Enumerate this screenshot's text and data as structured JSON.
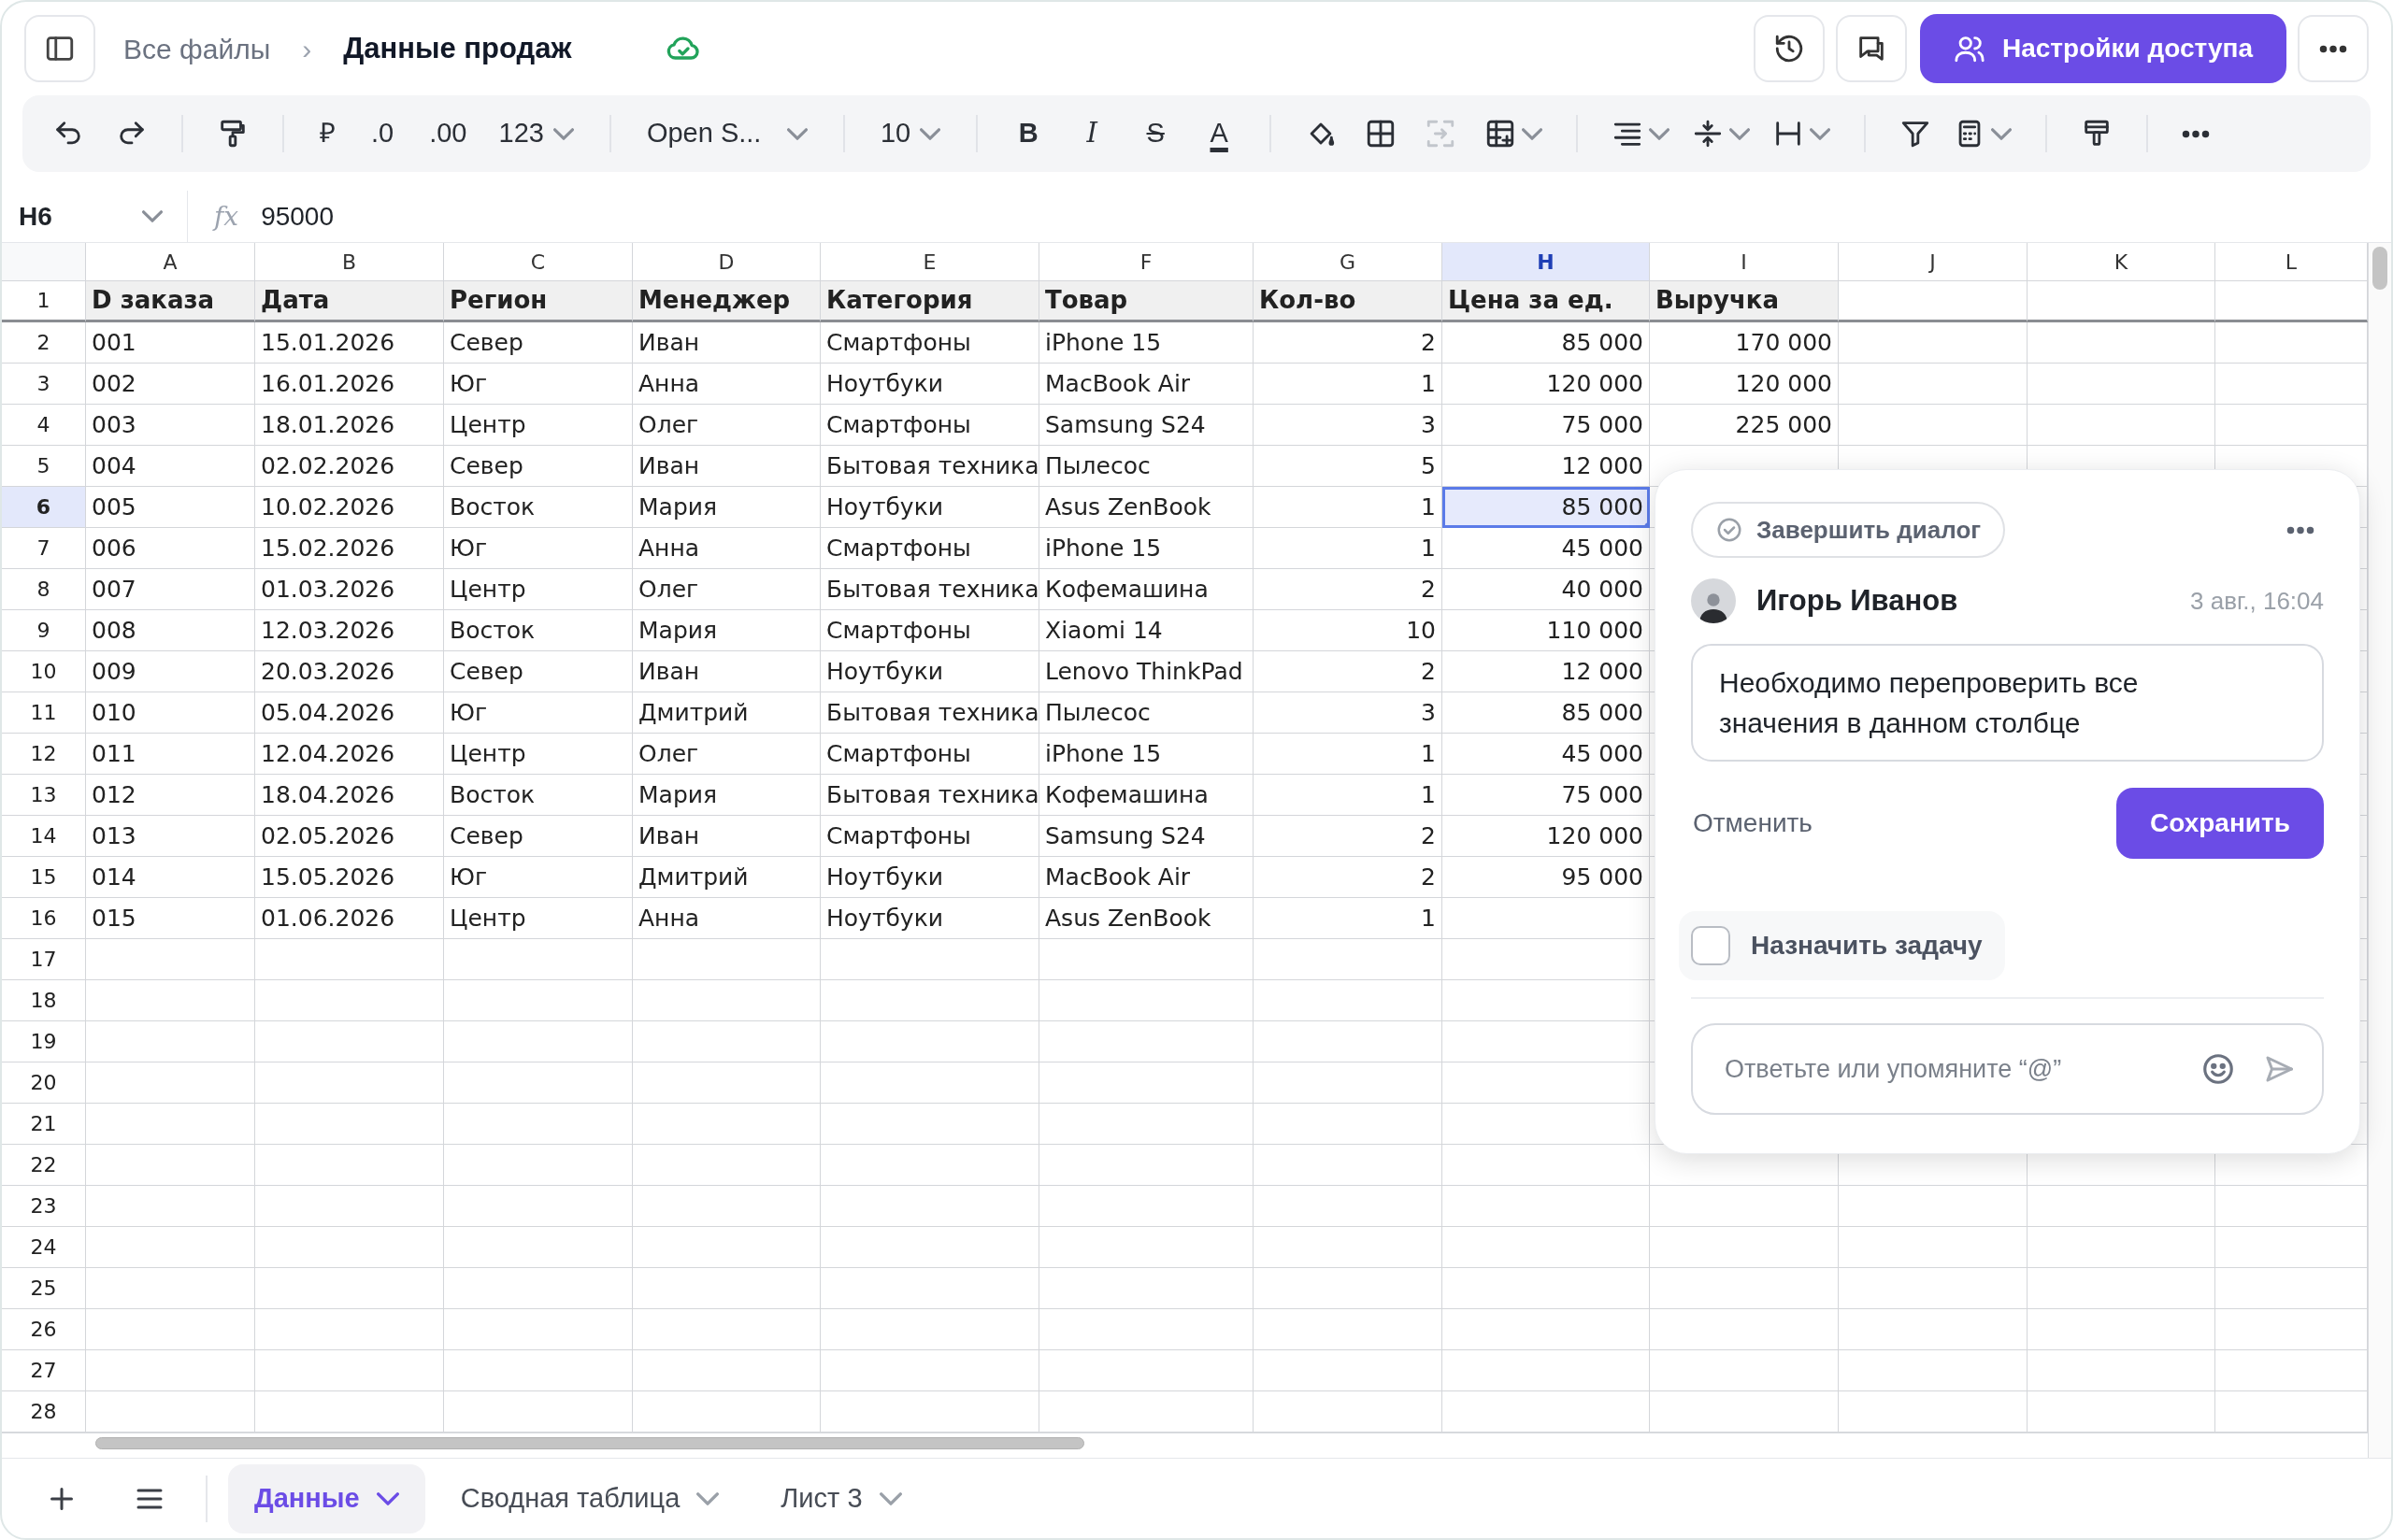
{
  "top_bar": {
    "breadcrumb_parent": "Все файлы",
    "breadcrumb_separator": "›",
    "title": "Данные продаж",
    "share_button": "Настройки доступа"
  },
  "toolbar": {
    "currency": "₽",
    "decimal_decrease": ".0",
    "decimal_increase": ".00",
    "number_format": "123",
    "font": "Open S...",
    "font_size": "10",
    "bold": "B",
    "italic": "I",
    "strikethrough": "S",
    "text_color": "A"
  },
  "formula_bar": {
    "cell_ref": "H6",
    "fx": "fx",
    "value": "95000"
  },
  "grid": {
    "columns": [
      {
        "letter": "A",
        "selected": false
      },
      {
        "letter": "B",
        "selected": false
      },
      {
        "letter": "C",
        "selected": false
      },
      {
        "letter": "D",
        "selected": false
      },
      {
        "letter": "E",
        "selected": false
      },
      {
        "letter": "F",
        "selected": false
      },
      {
        "letter": "G",
        "selected": false,
        "numeric": true
      },
      {
        "letter": "H",
        "selected": true,
        "numeric": true
      },
      {
        "letter": "I",
        "selected": false,
        "numeric": true
      },
      {
        "letter": "J",
        "selected": false
      },
      {
        "letter": "K",
        "selected": false
      },
      {
        "letter": "L",
        "selected": false
      }
    ],
    "rows": [
      {
        "number": "1",
        "kind": "header",
        "selected": false,
        "cells": [
          "D заказа",
          "Дата",
          "Регион",
          "Менеджер",
          "Категория",
          "Товар",
          "Кол-во",
          "Цена за ед.",
          "Выручка"
        ]
      },
      {
        "number": "2",
        "kind": "data",
        "selected": false,
        "cells": [
          "001",
          "15.01.2026",
          "Север",
          "Иван",
          "Смартфоны",
          "iPhone 15",
          "2",
          "85 000",
          "170 000"
        ]
      },
      {
        "number": "3",
        "kind": "data",
        "selected": false,
        "cells": [
          "002",
          "16.01.2026",
          "Юг",
          "Анна",
          "Ноутбуки",
          "MacBook Air",
          "1",
          "120 000",
          "120 000"
        ]
      },
      {
        "number": "4",
        "kind": "data",
        "selected": false,
        "cells": [
          "003",
          "18.01.2026",
          "Центр",
          "Олег",
          "Смартфоны",
          "Samsung S24",
          "3",
          "75 000",
          "225 000"
        ]
      },
      {
        "number": "5",
        "kind": "data",
        "selected": false,
        "cells": [
          "004",
          "02.02.2026",
          "Север",
          "Иван",
          "Бытовая техника",
          "Пылесос",
          "5",
          "12 000"
        ]
      },
      {
        "number": "6",
        "kind": "data",
        "selected": true,
        "cells": [
          "005",
          "10.02.2026",
          "Восток",
          "Мария",
          "Ноутбуки",
          "Asus ZenBook",
          "1",
          "85 000"
        ]
      },
      {
        "number": "7",
        "kind": "data",
        "selected": false,
        "cells": [
          "006",
          "15.02.2026",
          "Юг",
          "Анна",
          "Смартфоны",
          "iPhone 15",
          "1",
          "45 000"
        ]
      },
      {
        "number": "8",
        "kind": "data",
        "selected": false,
        "cells": [
          "007",
          "01.03.2026",
          "Центр",
          "Олег",
          "Бытовая техника",
          "Кофемашина",
          "2",
          "40 000"
        ]
      },
      {
        "number": "9",
        "kind": "data",
        "selected": false,
        "cells": [
          "008",
          "12.03.2026",
          "Восток",
          "Мария",
          "Смартфоны",
          "Xiaomi 14",
          "10",
          "110 000"
        ]
      },
      {
        "number": "10",
        "kind": "data",
        "selected": false,
        "cells": [
          "009",
          "20.03.2026",
          "Север",
          "Иван",
          "Ноутбуки",
          "Lenovo ThinkPad",
          "2",
          "12 000"
        ]
      },
      {
        "number": "11",
        "kind": "data",
        "selected": false,
        "cells": [
          "010",
          "05.04.2026",
          "Юг",
          "Дмитрий",
          "Бытовая техника",
          "Пылесос",
          "3",
          "85 000"
        ]
      },
      {
        "number": "12",
        "kind": "data",
        "selected": false,
        "cells": [
          "011",
          "12.04.2026",
          "Центр",
          "Олег",
          "Смартфоны",
          "iPhone 15",
          "1",
          "45 000"
        ]
      },
      {
        "number": "13",
        "kind": "data",
        "selected": false,
        "cells": [
          "012",
          "18.04.2026",
          "Восток",
          "Мария",
          "Бытовая техника",
          "Кофемашина",
          "1",
          "75 000"
        ]
      },
      {
        "number": "14",
        "kind": "data",
        "selected": false,
        "cells": [
          "013",
          "02.05.2026",
          "Север",
          "Иван",
          "Смартфоны",
          "Samsung S24",
          "2",
          "120 000"
        ]
      },
      {
        "number": "15",
        "kind": "data",
        "selected": false,
        "cells": [
          "014",
          "15.05.2026",
          "Юг",
          "Дмитрий",
          "Ноутбуки",
          "MacBook Air",
          "2",
          "95 000"
        ]
      },
      {
        "number": "16",
        "kind": "data",
        "selected": false,
        "cells": [
          "015",
          "01.06.2026",
          "Центр",
          "Анна",
          "Ноутбуки",
          "Asus ZenBook",
          "1"
        ]
      },
      {
        "number": "17",
        "kind": "data",
        "selected": false
      },
      {
        "number": "18",
        "kind": "data",
        "selected": false
      },
      {
        "number": "19",
        "kind": "data",
        "selected": false
      },
      {
        "number": "20",
        "kind": "data",
        "selected": false
      },
      {
        "number": "21",
        "kind": "data",
        "selected": false
      },
      {
        "number": "22",
        "kind": "data",
        "selected": false
      },
      {
        "number": "23",
        "kind": "data",
        "selected": false
      },
      {
        "number": "24",
        "kind": "data",
        "selected": false
      },
      {
        "number": "25",
        "kind": "data",
        "selected": false
      },
      {
        "number": "26",
        "kind": "data",
        "selected": false
      },
      {
        "number": "27",
        "kind": "data",
        "selected": false
      },
      {
        "number": "28",
        "kind": "data",
        "selected": false
      }
    ]
  },
  "comment_panel": {
    "resolve_button": "Завершить диалог",
    "author": "Игорь Иванов",
    "time": "3 авг., 16:04",
    "comment_text": "Необходимо перепроверить все значения в данном столбце",
    "cancel_button": "Отменить",
    "save_button": "Сохранить",
    "assign_task": {
      "label": "Назначить задачу",
      "checked": false
    },
    "reply_placeholder": "Ответьте или упомяните “@”"
  },
  "sheet_tabs": [
    {
      "label": "Данные",
      "selected": true
    },
    {
      "label": "Сводная таблица",
      "selected": false
    },
    {
      "label": "Лист 3",
      "selected": false
    }
  ]
}
